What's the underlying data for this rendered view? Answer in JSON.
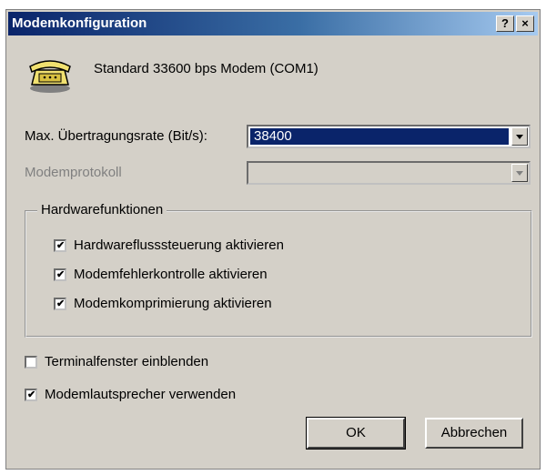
{
  "window": {
    "title": "Modemkonfiguration",
    "help_label": "?",
    "close_label": "×"
  },
  "device": {
    "name": "Standard 33600 bps Modem (COM1)"
  },
  "rate": {
    "label": "Max. Übertragungsrate (Bit/s):",
    "value": "38400"
  },
  "protocol": {
    "label": "Modemprotokoll",
    "value": ""
  },
  "hardware": {
    "title": "Hardwarefunktionen",
    "options": [
      {
        "label": "Hardwareflusssteuerung aktivieren",
        "checked": true
      },
      {
        "label": "Modemfehlerkontrolle aktivieren",
        "checked": true
      },
      {
        "label": "Modemkomprimierung aktivieren",
        "checked": true
      }
    ]
  },
  "terminal": {
    "label": "Terminalfenster einblenden",
    "checked": false
  },
  "speaker": {
    "label": "Modemlautsprecher verwenden",
    "checked": true
  },
  "buttons": {
    "ok": "OK",
    "cancel": "Abbrechen"
  },
  "check_mark": "✔"
}
